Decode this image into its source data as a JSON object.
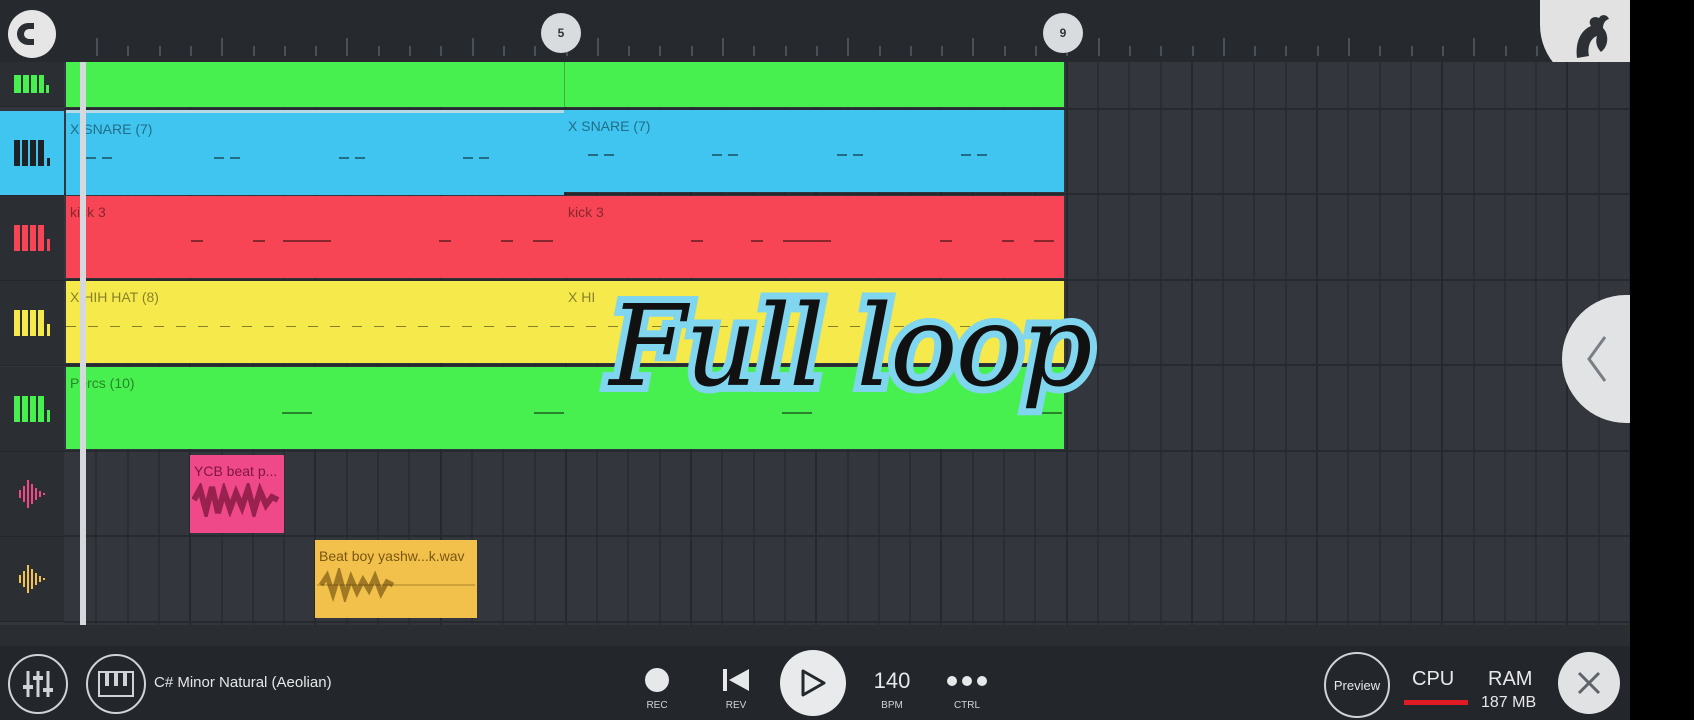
{
  "timeline": {
    "markers": [
      "5",
      "9"
    ]
  },
  "tracks": [
    {
      "id": "t1",
      "type": "pattern",
      "color": "#48f04f"
    },
    {
      "id": "t2",
      "type": "pattern",
      "color": "#3fc5f0",
      "selected": true
    },
    {
      "id": "t3",
      "type": "pattern",
      "color": "#f74555"
    },
    {
      "id": "t4",
      "type": "pattern",
      "color": "#f6e94b"
    },
    {
      "id": "t5",
      "type": "pattern",
      "color": "#48f04f"
    },
    {
      "id": "t6",
      "type": "audio",
      "color": "#f0498a"
    },
    {
      "id": "t7",
      "type": "audio",
      "color": "#f2c14b"
    }
  ],
  "clips": {
    "snare_a": "X SNARE (7)",
    "snare_b": "X SNARE (7)",
    "kick_a": "kick 3",
    "kick_b": "kick 3",
    "hihat_a": "X HIH HAT (8)",
    "hihat_b": "X HI",
    "percs": "Percs (10)",
    "ycb": "YCB beat p...",
    "beatboy": "Beat boy yashw...k.wav"
  },
  "overlay_text": "Full loop",
  "bottom": {
    "scale": "C# Minor Natural (Aeolian)",
    "rec_label": "REC",
    "rev_label": "REV",
    "bpm_value": "140",
    "bpm_label": "BPM",
    "ctrl_label": "CTRL",
    "preview_label": "Preview",
    "cpu_label": "CPU",
    "ram_label": "RAM",
    "ram_value": "187 MB"
  },
  "colors": {
    "green": "#48f04f",
    "blue": "#3fc5f0",
    "red": "#f74555",
    "yellow": "#f6e94b",
    "pink": "#f0498a",
    "orange": "#f2c14b",
    "cpu_meter": "#e01b24"
  },
  "icons": [
    "magnet-icon",
    "fl-studio-logo",
    "mixer-icon",
    "piano-icon",
    "waveform-icon",
    "record-icon",
    "rewind-icon",
    "play-icon",
    "more-icon",
    "close-icon",
    "chevron-left-icon"
  ]
}
